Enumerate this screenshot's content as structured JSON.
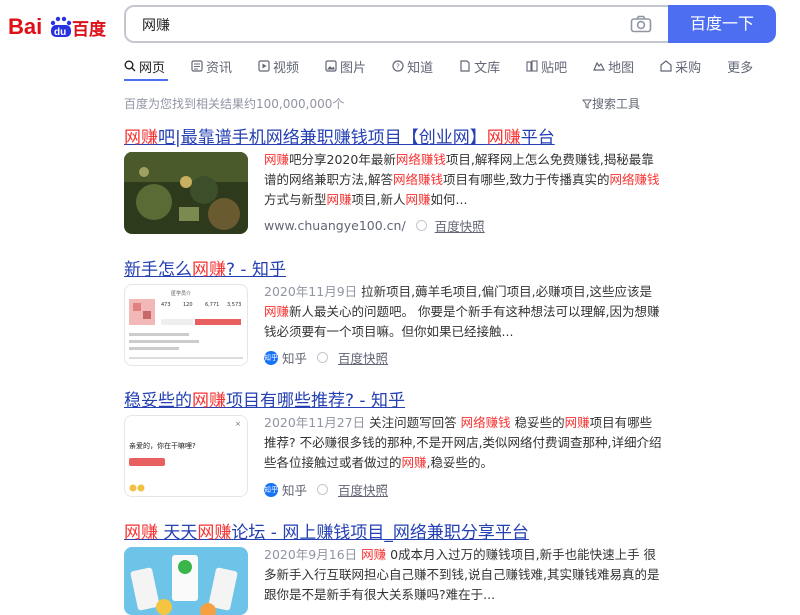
{
  "header": {
    "logo_text_left": "Bai",
    "logo_text_du": "du",
    "logo_text_right": "百度",
    "search_value": "网赚",
    "search_button": "百度一下"
  },
  "tabs": [
    {
      "label": "网页",
      "icon": "search-icon"
    },
    {
      "label": "资讯",
      "icon": "news-icon"
    },
    {
      "label": "视频",
      "icon": "video-icon"
    },
    {
      "label": "图片",
      "icon": "image-icon"
    },
    {
      "label": "知道",
      "icon": "question-icon"
    },
    {
      "label": "文库",
      "icon": "document-icon"
    },
    {
      "label": "贴吧",
      "icon": "tieba-icon"
    },
    {
      "label": "地图",
      "icon": "map-icon"
    },
    {
      "label": "采购",
      "icon": "purchase-icon"
    },
    {
      "label": "更多",
      "icon": ""
    }
  ],
  "result_count": "百度为您找到相关结果约100,000,000个",
  "tools_label": "搜索工具",
  "results": [
    {
      "title_parts": [
        "网赚",
        "吧|最靠谱手机网络兼职赚钱项目【创业网】",
        "网赚",
        "平台"
      ],
      "snippet_parts": [
        "网赚",
        "吧分享2020年最新",
        "网络赚钱",
        "项目,解释网上怎么免费赚钱,揭秘最靠谱的网络兼职方法,解答",
        "网络赚钱",
        "项目有哪些,致力于传播真实的",
        "网络赚钱",
        "方式与新型",
        "网赚",
        "项目,新人",
        "网赚",
        "如何..."
      ],
      "source": "www.chuangye100.cn/",
      "kuaizhao": "百度快照"
    },
    {
      "title_parts": [
        "新手怎么",
        "网赚",
        "? - 知乎"
      ],
      "date": "2020年11月9日",
      "snippet_parts": [
        " 拉新项目,薅羊毛项目,偏门项目,必赚项目,这些应该是",
        "网赚",
        "新人最关心的问题吧。 你要是个新手有这种想法可以理解,因为想赚钱必须要有一个项目嘛。但你如果已经接触..."
      ],
      "source": "知乎",
      "kuaizhao": "百度快照",
      "thumb_text": {
        "name": "匿学员介",
        "stat1": "473",
        "stat2": "120",
        "stat3": "6,771",
        "stat4": "3,573"
      }
    },
    {
      "title_parts": [
        "稳妥些的",
        "网赚",
        "项目有哪些推荐? - 知乎"
      ],
      "date": "2020年11月27日",
      "snippet_parts": [
        " 关注问题写回答 ",
        "网络赚钱",
        " 稳妥些的",
        "网赚",
        "项目有哪些推荐? 不必赚很多钱的那种,不是开网店,类似网络付费调查那种,详细介绍些各位接触过或者做过的",
        "网赚",
        ",稳妥些的。"
      ],
      "source": "知乎",
      "kuaizhao": "百度快照",
      "thumb_text": {
        "line1": "亲爱的，你在干嘛哩?",
        "top": "×"
      }
    },
    {
      "title_parts": [
        "网赚",
        " 天天",
        "网赚",
        "论坛 - 网上赚钱项目_网络兼职分享平台"
      ],
      "date": "2020年9月16日",
      "snippet_parts": [
        " ",
        "网赚",
        " 0成本月入过万的赚钱项目,新手也能快速上手 很多新手入行互联网担心自己赚不到钱,说自己赚钱难,其实赚钱难易真的是跟你是不是新手有很大关系赚吗?难在于..."
      ]
    }
  ],
  "colors": {
    "brand_blue": "#4e6ef2",
    "link_blue": "#2440b3",
    "highlight_red": "#f73131",
    "logo_red": "#de0f17",
    "logo_blue": "#2932e1"
  }
}
